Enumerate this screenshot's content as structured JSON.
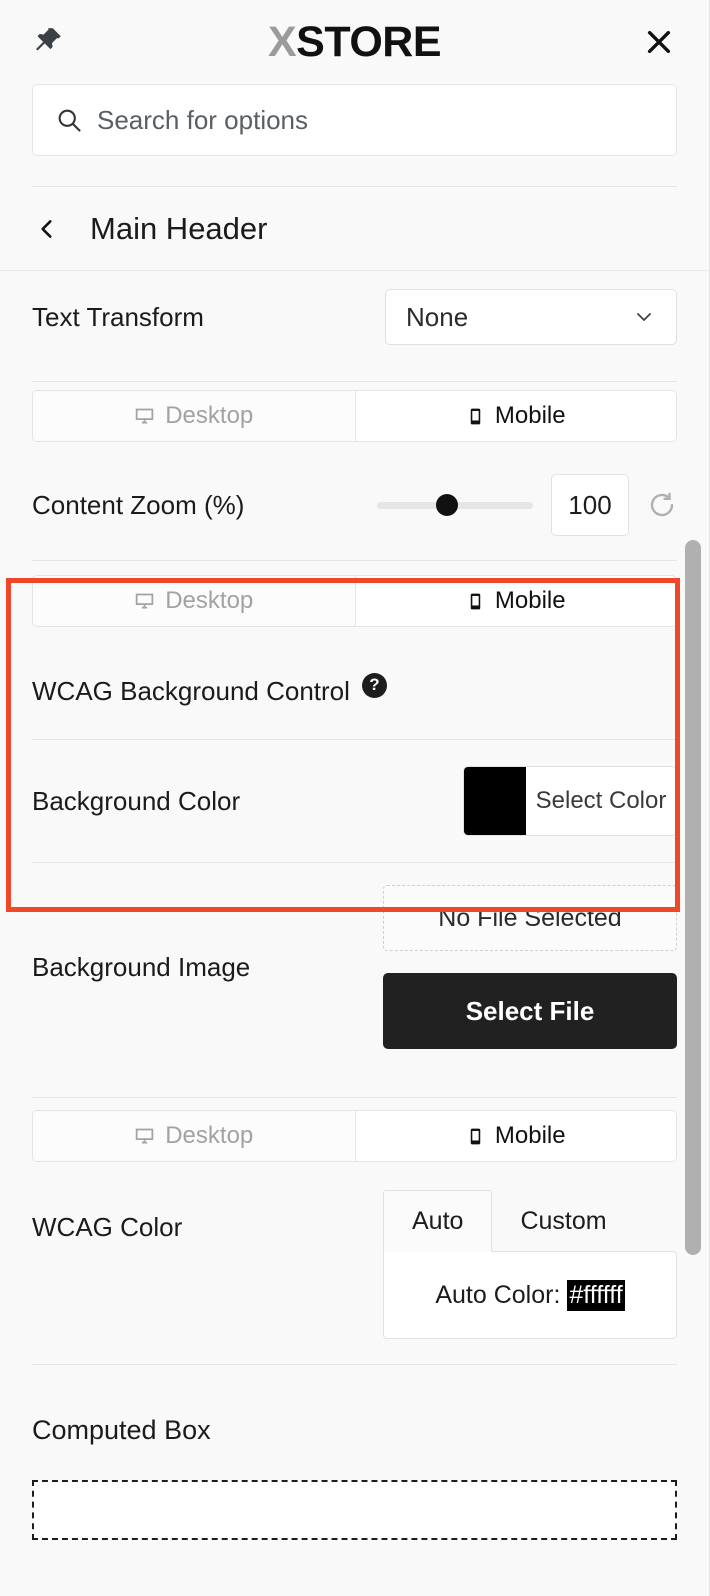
{
  "window": {
    "pin_icon": "pin-icon",
    "brand_prefix": "X",
    "brand_suffix": "STORE",
    "close_icon": "close-icon"
  },
  "search": {
    "icon": "search-icon",
    "placeholder": "Search for options",
    "value": ""
  },
  "section": {
    "back_icon": "chevron-left-icon",
    "title": "Main Header"
  },
  "text_transform": {
    "label": "Text Transform",
    "value": "None",
    "caret_icon": "chevron-down-icon"
  },
  "device_toggle_1": {
    "desktop_label": "Desktop",
    "mobile_label": "Mobile",
    "desktop_icon": "monitor-icon",
    "mobile_icon": "mobile-icon",
    "active": "Mobile"
  },
  "content_zoom": {
    "label": "Content Zoom (%)",
    "value": "100",
    "slider_percent": 45,
    "reset_icon": "reset-icon"
  },
  "device_toggle_2": {
    "desktop_label": "Desktop",
    "mobile_label": "Mobile",
    "desktop_icon": "monitor-icon",
    "mobile_icon": "mobile-icon",
    "active": "Mobile"
  },
  "wcag_background_control": {
    "label": "WCAG Background Control",
    "help_icon": "help-icon",
    "help_glyph": "?"
  },
  "background_color": {
    "label": "Background Color",
    "swatch_color": "#000000",
    "button_label": "Select Color"
  },
  "background_image": {
    "label": "Background Image",
    "no_file_label": "No File Selected",
    "select_file_label": "Select File"
  },
  "device_toggle_3": {
    "desktop_label": "Desktop",
    "mobile_label": "Mobile",
    "desktop_icon": "monitor-icon",
    "mobile_icon": "mobile-icon",
    "active": "Mobile"
  },
  "wcag_color": {
    "label": "WCAG Color",
    "tab_auto": "Auto",
    "tab_custom": "Custom",
    "active_tab": "Auto",
    "auto_color_prefix": "Auto Color:",
    "auto_color_value": "#ffffff"
  },
  "computed_box": {
    "label": "Computed Box"
  },
  "colors": {
    "highlight": "#f0462a",
    "accent_dark": "#212121",
    "scrollbar": "#b0b0b0"
  }
}
